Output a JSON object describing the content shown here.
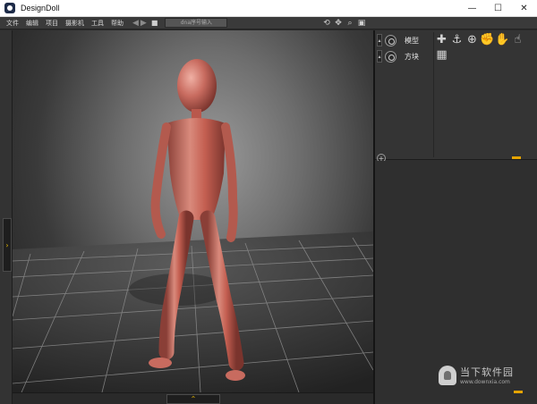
{
  "window": {
    "title": "DesignDoll",
    "minimize": "—",
    "maximize": "☐",
    "close": "✕"
  },
  "menu": {
    "items": [
      "文件",
      "编辑",
      "项目",
      "摄影机",
      "工具",
      "帮助"
    ]
  },
  "toolbar": {
    "dna_placeholder": "dna序号输入"
  },
  "panel": {
    "rows": [
      {
        "label": "模型"
      },
      {
        "label": "方块"
      }
    ]
  },
  "watermark": {
    "name": "当下软件园",
    "url": "www.downxia.com"
  },
  "colors": {
    "accent": "#e6a400",
    "viewport_bg": "#6d6d6d",
    "doll": "#c86b5f"
  },
  "icons": {
    "titlebar": "designdoll-logo-icon",
    "tools": [
      "rotate-icon",
      "move-icon",
      "zoom-icon",
      "camera-icon"
    ],
    "panel": [
      "sphere-icon",
      "anchor-icon",
      "zoom-in-icon",
      "hand-icon",
      "hand-open-icon",
      "hand-point-icon",
      "cube-icon"
    ]
  }
}
